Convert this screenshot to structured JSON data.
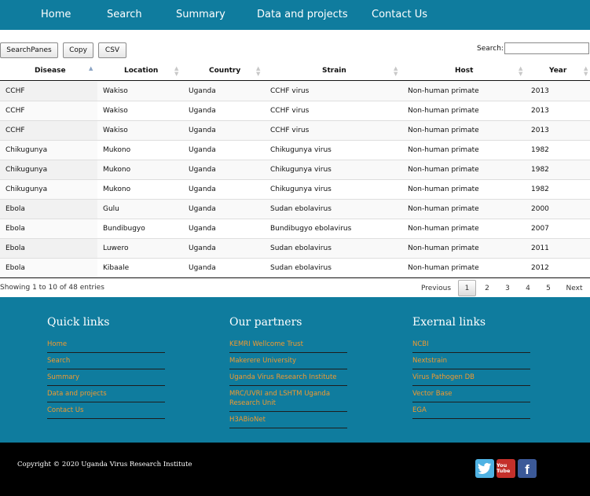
{
  "nav": {
    "items": [
      {
        "label": "Home"
      },
      {
        "label": "Search"
      },
      {
        "label": "Summary"
      },
      {
        "label": "Data and projects"
      },
      {
        "label": "Contact Us"
      }
    ]
  },
  "toolbar": {
    "searchpanes_label": "SearchPanes",
    "copy_label": "Copy",
    "csv_label": "CSV",
    "search_label": "Search:",
    "search_value": ""
  },
  "table": {
    "headers": [
      "Disease",
      "Location",
      "Country",
      "Strain",
      "Host",
      "Year"
    ],
    "sorted_column": "Disease",
    "rows": [
      [
        "CCHF",
        "Wakiso",
        "Uganda",
        "CCHF virus",
        "Non-human primate",
        "2013"
      ],
      [
        "CCHF",
        "Wakiso",
        "Uganda",
        "CCHF virus",
        "Non-human primate",
        "2013"
      ],
      [
        "CCHF",
        "Wakiso",
        "Uganda",
        "CCHF virus",
        "Non-human primate",
        "2013"
      ],
      [
        "Chikugunya",
        "Mukono",
        "Uganda",
        "Chikugunya virus",
        "Non-human primate",
        "1982"
      ],
      [
        "Chikugunya",
        "Mukono",
        "Uganda",
        "Chikugunya virus",
        "Non-human primate",
        "1982"
      ],
      [
        "Chikugunya",
        "Mukono",
        "Uganda",
        "Chikugunya virus",
        "Non-human primate",
        "1982"
      ],
      [
        "Ebola",
        "Gulu",
        "Uganda",
        "Sudan ebolavirus",
        "Non-human primate",
        "2000"
      ],
      [
        "Ebola",
        "Bundibugyo",
        "Uganda",
        "Bundibugyo ebolavirus",
        "Non-human primate",
        "2007"
      ],
      [
        "Ebola",
        "Luwero",
        "Uganda",
        "Sudan ebolavirus",
        "Non-human primate",
        "2011"
      ],
      [
        "Ebola",
        "Kibaale",
        "Uganda",
        "Sudan ebolavirus",
        "Non-human primate",
        "2012"
      ]
    ],
    "info": "Showing 1 to 10 of 48 entries"
  },
  "pagination": {
    "previous_label": "Previous",
    "pages": [
      "1",
      "2",
      "3",
      "4",
      "5"
    ],
    "current_page": "1",
    "next_label": "Next"
  },
  "footer": {
    "quick_links": {
      "title": "Quick links",
      "links": [
        "Home",
        "Search",
        "Summary",
        "Data and projects",
        "Contact Us"
      ]
    },
    "partners": {
      "title": "Our partners",
      "links": [
        "KEMRI Wellcome Trust",
        "Makerere University",
        "Uganda Virus Research Institute",
        "MRC/UVRI and LSHTM Uganda Research Unit",
        "H3ABioNet"
      ]
    },
    "external": {
      "title": "Exernal links",
      "links": [
        "NCBI",
        "Nextstrain",
        "Virus Pathogen DB",
        "Vector Base",
        "EGA"
      ]
    },
    "copyright": "Copyright © 2020 Uganda Virus Research Institute",
    "social": [
      {
        "icon": "twitter-icon",
        "color": "#4fb2e3"
      },
      {
        "icon": "youtube-icon",
        "color": "#c4302b",
        "label": "You Tube"
      },
      {
        "icon": "facebook-icon",
        "color": "#3b5998"
      }
    ]
  },
  "colors": {
    "brand": "#0f7c9e",
    "link": "#f29a2e",
    "footer_bottom": "#000000"
  }
}
